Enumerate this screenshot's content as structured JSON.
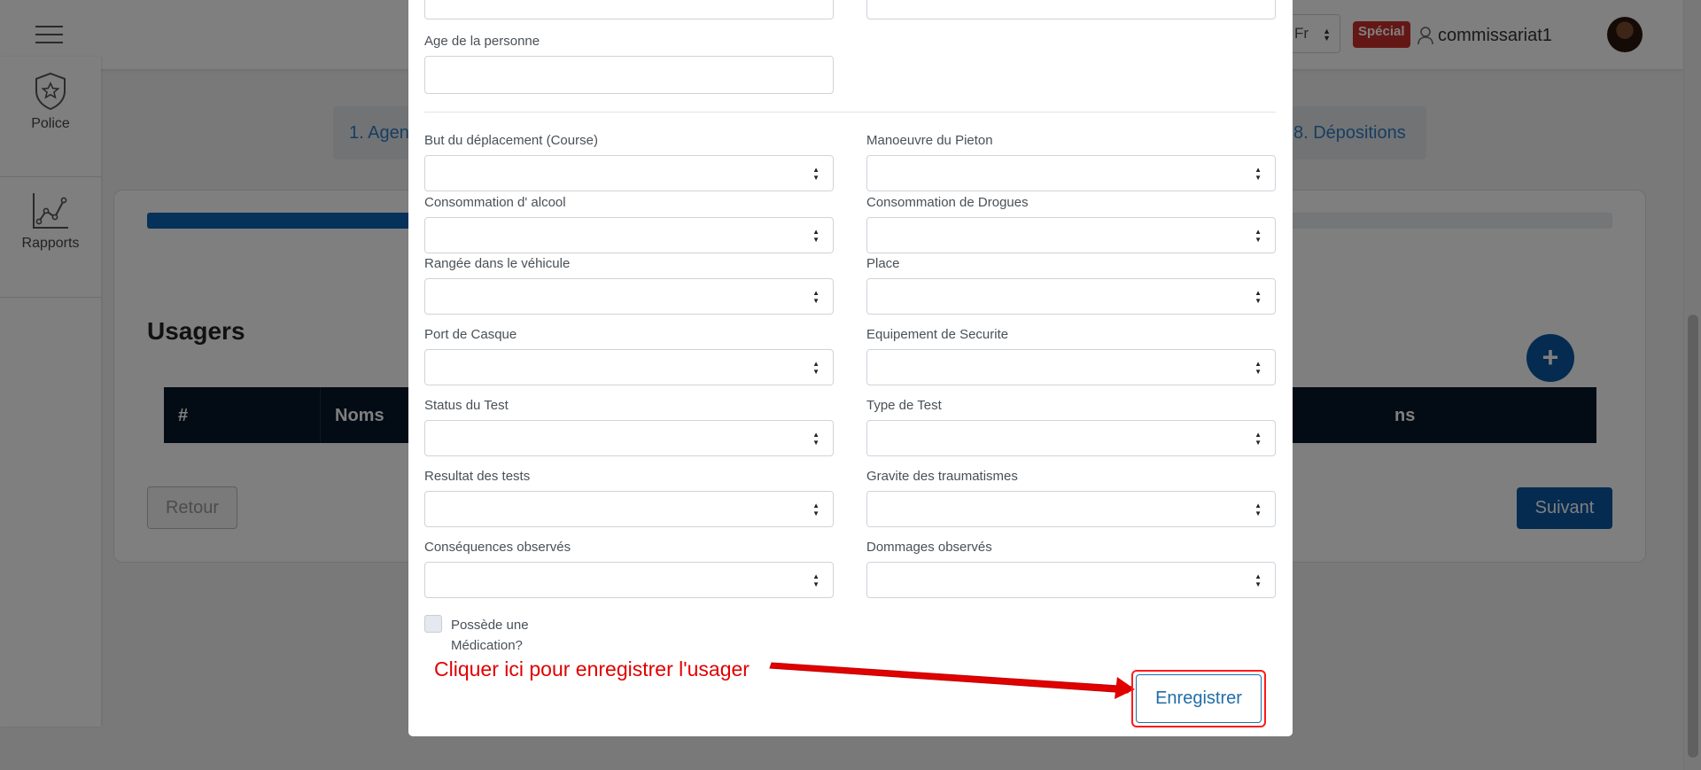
{
  "header": {
    "lang": "Fr",
    "badge": "Spécial",
    "username": "commissariat1"
  },
  "sidebar": {
    "items": [
      {
        "label": "Police",
        "icon": "police-badge-icon"
      },
      {
        "label": "Rapports",
        "icon": "chart-line-icon"
      }
    ]
  },
  "steps": {
    "left": "1. Agen",
    "right": "8. Dépositions"
  },
  "page": {
    "progress_fraction": 0.18,
    "section_title": "Usagers",
    "add_label": "+",
    "table_headers": [
      "#",
      "Noms",
      "ns"
    ],
    "back_label": "Retour",
    "next_label": "Suivant"
  },
  "modal": {
    "age_label": "Age de la personne",
    "fields": [
      {
        "label": "But du déplacement (Course)"
      },
      {
        "label": "Manoeuvre du Pieton"
      },
      {
        "label": "Consommation d' alcool"
      },
      {
        "label": "Consommation de Drogues"
      },
      {
        "label": "Rangée dans le véhicule"
      },
      {
        "label": "Place"
      },
      {
        "label": "Port de Casque"
      },
      {
        "label": "Equipement de Securite"
      },
      {
        "label": "Status du Test"
      },
      {
        "label": "Type de Test"
      },
      {
        "label": "Resultat des tests"
      },
      {
        "label": "Gravite des traumatismes"
      },
      {
        "label": "Conséquences observés"
      },
      {
        "label": "Dommages observés"
      }
    ],
    "medication_label": "Possède une Médication?",
    "annotation": "Cliquer ici pour enregistrer l'usager",
    "save_label": "Enregistrer"
  },
  "colors": {
    "accent": "#0a57a3",
    "annotation": "#e00000",
    "table_header": "#07162a"
  }
}
